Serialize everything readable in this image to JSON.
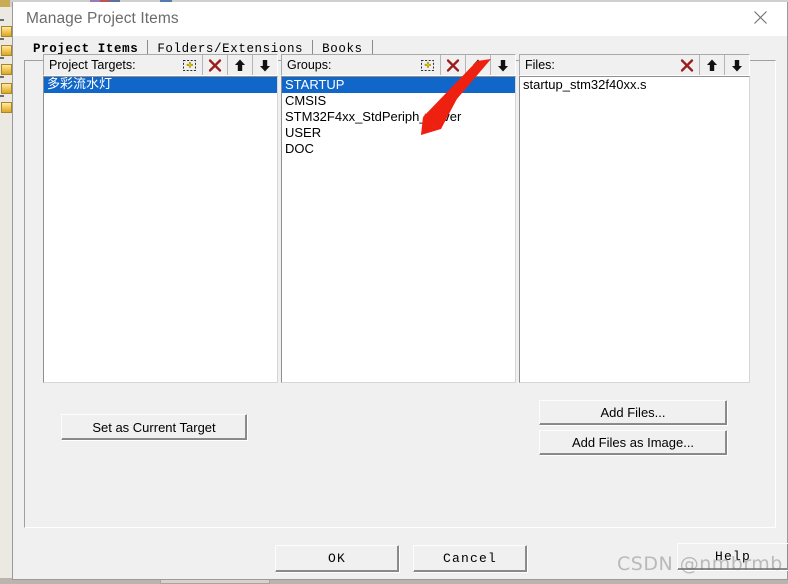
{
  "window": {
    "title": "Manage Project Items",
    "close_icon": "close-icon"
  },
  "tabs": [
    {
      "label": "Project Items",
      "active": true
    },
    {
      "label": "Folders/Extensions",
      "active": false
    },
    {
      "label": "Books",
      "active": false
    }
  ],
  "columns": {
    "targets": {
      "label": "Project Targets:",
      "buttons": [
        {
          "name": "new-target-button",
          "icon": "new-item-icon"
        },
        {
          "name": "delete-target-button",
          "icon": "delete-x-icon"
        },
        {
          "name": "move-target-up-button",
          "icon": "arrow-up-icon"
        },
        {
          "name": "move-target-down-button",
          "icon": "arrow-down-icon"
        }
      ],
      "items": [
        {
          "label": "多彩流水灯",
          "selected": true,
          "cjk": true
        }
      ]
    },
    "groups": {
      "label": "Groups:",
      "buttons": [
        {
          "name": "new-group-button",
          "icon": "new-item-icon"
        },
        {
          "name": "delete-group-button",
          "icon": "delete-x-icon"
        },
        {
          "name": "move-group-up-button",
          "icon": "arrow-up-icon"
        },
        {
          "name": "move-group-down-button",
          "icon": "arrow-down-icon"
        }
      ],
      "items": [
        {
          "label": "STARTUP",
          "selected": true
        },
        {
          "label": "CMSIS",
          "selected": false
        },
        {
          "label": "STM32F4xx_StdPeriph_Driver",
          "selected": false
        },
        {
          "label": "USER",
          "selected": false
        },
        {
          "label": "DOC",
          "selected": false
        }
      ]
    },
    "files": {
      "label": "Files:",
      "buttons": [
        {
          "name": "delete-file-button",
          "icon": "delete-x-icon"
        },
        {
          "name": "move-file-up-button",
          "icon": "arrow-up-icon"
        },
        {
          "name": "move-file-down-button",
          "icon": "arrow-down-icon"
        }
      ],
      "items": [
        {
          "label": "startup_stm32f40xx.s",
          "selected": false
        }
      ]
    }
  },
  "buttons": {
    "set_as_current_target": "Set as Current Target",
    "add_files": "Add Files...",
    "add_files_as_image": "Add Files as Image...",
    "ok": "OK",
    "cancel": "Cancel",
    "help": "Help"
  },
  "annotation": {
    "arrow_color": "#ee2010",
    "points_to": "new-group-button"
  },
  "watermark": {
    "text": "CSDN @nmbrmb"
  },
  "colors": {
    "selection": "#1167c9",
    "dialog_face": "#f0f0f0",
    "listbox_bg": "#ffffff",
    "title_text": "#6b6b6b",
    "delete_icon": "#9e1b1b"
  }
}
